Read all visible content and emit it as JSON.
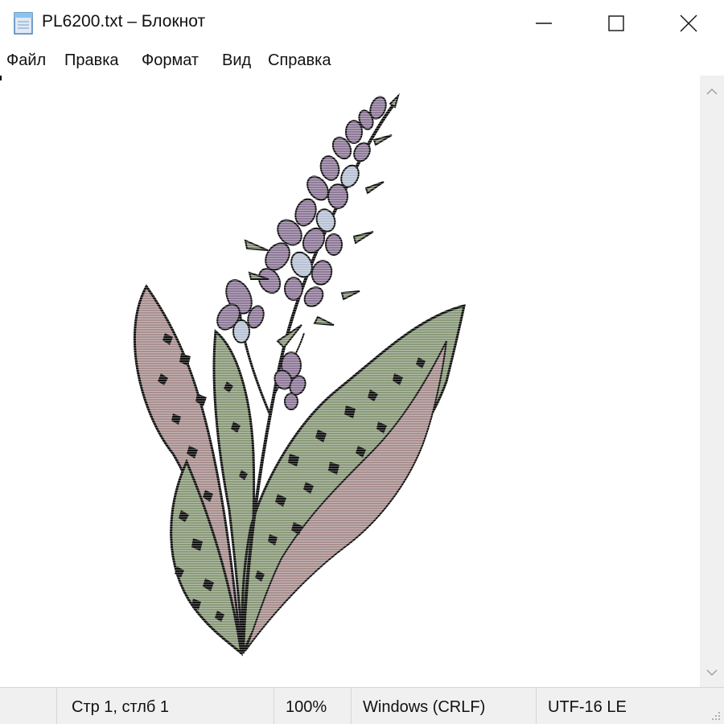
{
  "window": {
    "title": "PL6200.txt – Блокнот",
    "app_icon": "notepad-icon"
  },
  "controls": {
    "minimize_icon": "minimize-icon",
    "maximize_icon": "maximize-icon",
    "close_icon": "close-icon"
  },
  "menu": {
    "items": [
      {
        "label": "Файл"
      },
      {
        "label": "Правка"
      },
      {
        "label": "Формат"
      },
      {
        "label": "Вид"
      },
      {
        "label": "Справка"
      }
    ]
  },
  "document": {
    "content": "ascii-art illustration of a flowering plant with purple blossoms and spotted green-and-mauve leaves",
    "colors": {
      "flower": "#8f7a99",
      "flower_light": "#b9c3d6",
      "leaf_green": "#8a9a7a",
      "leaf_mauve": "#a98f8f",
      "ink": "#111111"
    }
  },
  "status": {
    "position": "Стр 1, стлб 1",
    "zoom": "100%",
    "line_endings": "Windows (CRLF)",
    "encoding": "UTF-16 LE"
  }
}
